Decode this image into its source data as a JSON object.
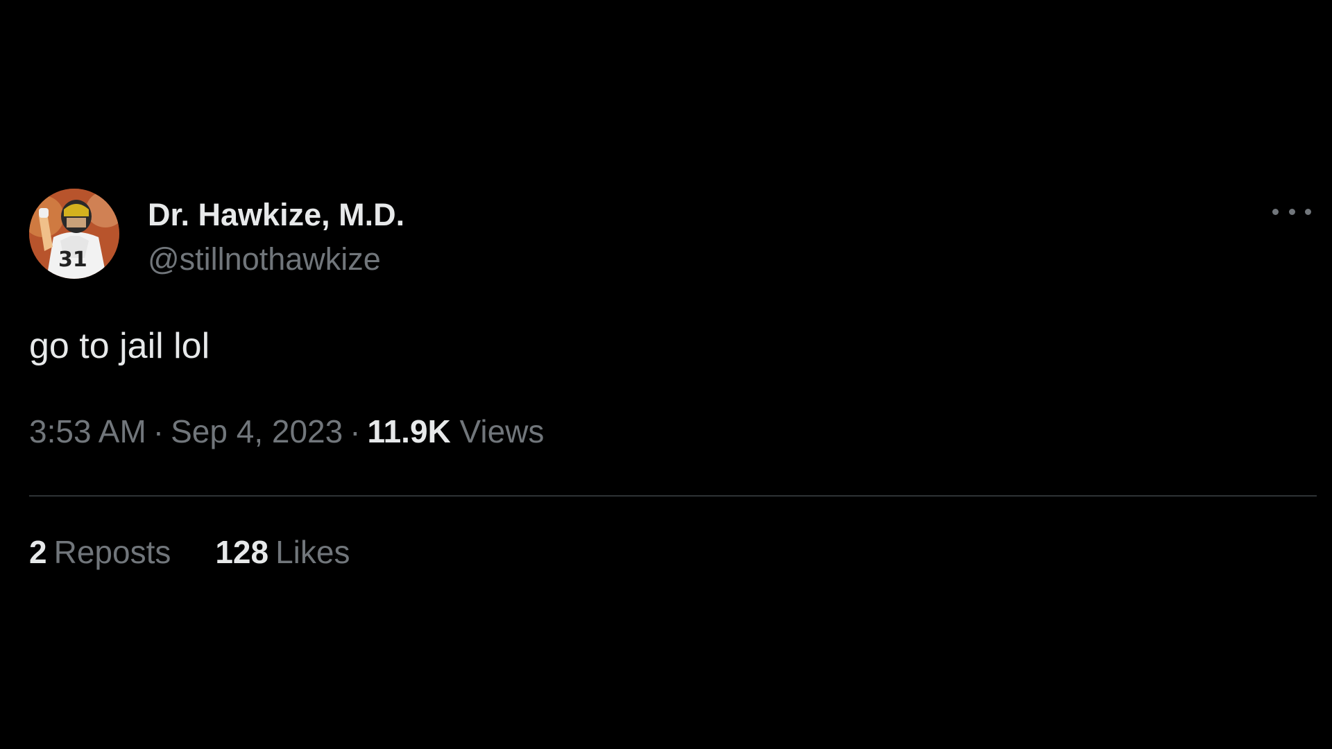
{
  "tweet": {
    "author": {
      "display_name": "Dr. Hawkize, M.D.",
      "handle": "@stillnothawkize",
      "avatar_icon": "football-player-avatar"
    },
    "text": "go to jail lol",
    "time": "3:53 AM",
    "date": "Sep 4, 2023",
    "separator": "·",
    "views_count": "11.9K",
    "views_label": "Views",
    "reposts_count": "2",
    "reposts_label": "Reposts",
    "likes_count": "128",
    "likes_label": "Likes",
    "more_icon": "more-horizontal-icon"
  },
  "colors": {
    "background": "#000000",
    "primary_text": "#e7e9ea",
    "secondary_text": "#71767b",
    "divider": "#2f3336"
  }
}
